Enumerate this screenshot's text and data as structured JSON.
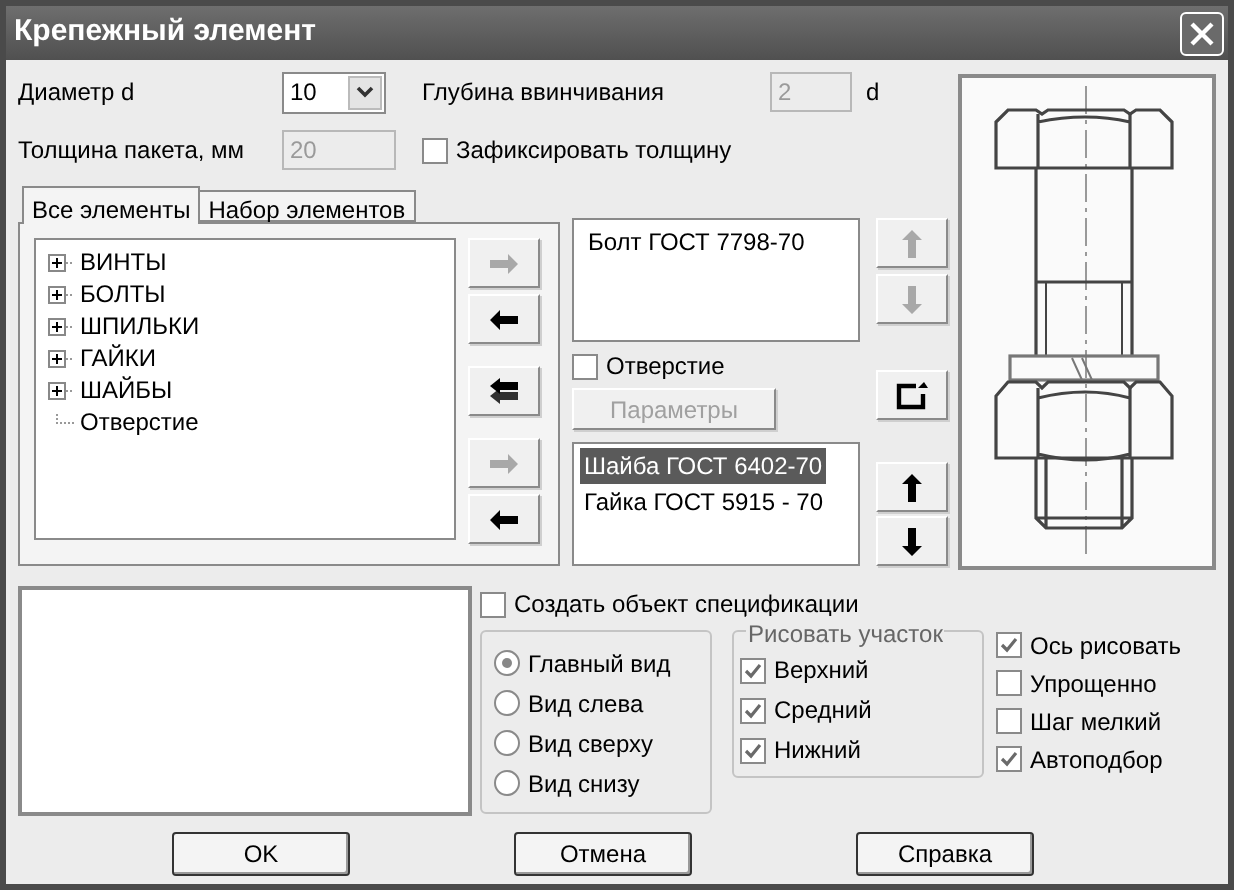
{
  "window": {
    "title": "Крепежный элемент"
  },
  "diameter": {
    "label": "Диаметр d",
    "value": "10"
  },
  "depth": {
    "label": "Глубина ввинчивания",
    "value": "2",
    "unit": "d",
    "disabled": true
  },
  "thickness": {
    "label": "Толщина пакета, мм",
    "value": "20",
    "disabled": true
  },
  "fix_thickness": {
    "label": "Зафиксировать толщину",
    "checked": false
  },
  "tabs": [
    {
      "label": "Все элементы",
      "selected": true
    },
    {
      "label": "Набор элементов",
      "selected": false
    }
  ],
  "tree": [
    {
      "label": "ВИНТЫ",
      "expandable": true
    },
    {
      "label": "БОЛТЫ",
      "expandable": true
    },
    {
      "label": "ШПИЛЬКИ",
      "expandable": true
    },
    {
      "label": "ГАЙКИ",
      "expandable": true
    },
    {
      "label": "ШАЙБЫ",
      "expandable": true
    },
    {
      "label": "Отверстие",
      "expandable": false
    }
  ],
  "transfer_buttons": [
    {
      "kind": "right",
      "disabled": true
    },
    {
      "kind": "left",
      "disabled": false
    },
    {
      "kind": "left-all",
      "disabled": false
    },
    {
      "kind": "right",
      "disabled": true
    },
    {
      "kind": "left",
      "disabled": false
    }
  ],
  "upper_list": [
    {
      "label": "Болт ГОСТ 7798-70",
      "selected": false
    }
  ],
  "upper_order": [
    {
      "kind": "up",
      "disabled": true
    },
    {
      "kind": "down",
      "disabled": true
    }
  ],
  "hole": {
    "label": "Отверстие",
    "checked": false
  },
  "params_button": {
    "label": "Параметры",
    "disabled": true
  },
  "lower_list": [
    {
      "label": "Шайба ГОСТ 6402-70",
      "selected": true
    },
    {
      "label": "Гайка ГОСТ 5915 - 70",
      "selected": false
    }
  ],
  "lower_order": [
    {
      "kind": "up",
      "disabled": false
    },
    {
      "kind": "down",
      "disabled": false
    }
  ],
  "spec": {
    "label": "Создать объект спецификации",
    "checked": false
  },
  "views": [
    {
      "label": "Главный вид",
      "selected": true
    },
    {
      "label": "Вид слева",
      "selected": false
    },
    {
      "label": "Вид сверху",
      "selected": false
    },
    {
      "label": "Вид снизу",
      "selected": false
    }
  ],
  "draw_section": {
    "title": "Рисовать участок",
    "items": [
      {
        "label": "Верхний",
        "checked": true
      },
      {
        "label": "Средний",
        "checked": true
      },
      {
        "label": "Нижний",
        "checked": true
      }
    ]
  },
  "options": [
    {
      "label": "Ось рисовать",
      "checked": true
    },
    {
      "label": "Упрощенно",
      "checked": false
    },
    {
      "label": "Шаг мелкий",
      "checked": false
    },
    {
      "label": "Автоподбор",
      "checked": true
    }
  ],
  "buttons": [
    {
      "label": "OK"
    },
    {
      "label": "Отмена"
    },
    {
      "label": "Справка"
    }
  ]
}
